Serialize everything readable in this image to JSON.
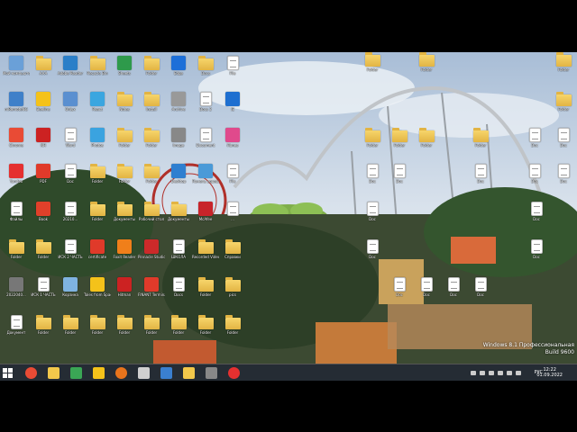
{
  "desktop": {
    "icons": [
      {
        "label": "Мой компьютер",
        "kind": "app",
        "color": "#6aa0d8"
      },
      {
        "label": "AAA",
        "kind": "folder",
        "color": "#f2c84b"
      },
      {
        "label": "Adobe Reader",
        "kind": "app",
        "color": "#2b7fc8"
      },
      {
        "label": "Recycle Bin",
        "kind": "folder",
        "color": "#f2c84b"
      },
      {
        "label": "Sheets",
        "kind": "app",
        "color": "#2e9a4b"
      },
      {
        "label": "Folder",
        "kind": "folder",
        "color": "#f2c84b"
      },
      {
        "label": "Edge",
        "kind": "app",
        "color": "#1d6fd8"
      },
      {
        "label": "Docs",
        "kind": "folder",
        "color": "#f2c84b"
      },
      {
        "label": "File",
        "kind": "doc",
        "color": "#ffffff"
      },
      {
        "label": "mRemoteNG",
        "kind": "app",
        "color": "#3f80c9"
      },
      {
        "label": "Beeline",
        "kind": "app",
        "color": "#f4c21a"
      },
      {
        "label": "Onlyx",
        "kind": "app",
        "color": "#5a8fd0"
      },
      {
        "label": "React",
        "kind": "app",
        "color": "#3ba6e0"
      },
      {
        "label": "Notes",
        "kind": "folder",
        "color": "#f2c84b"
      },
      {
        "label": "Install",
        "kind": "folder",
        "color": "#f2c84b"
      },
      {
        "label": "Archive",
        "kind": "app",
        "color": "#999999"
      },
      {
        "label": "Docs 2",
        "kind": "doc",
        "color": "#ffffff"
      },
      {
        "label": "IE",
        "kind": "app",
        "color": "#1e6fd0"
      },
      {
        "label": "Chrome",
        "kind": "app",
        "color": "#e94b35"
      },
      {
        "label": "NH",
        "kind": "app",
        "color": "#cc2222"
      },
      {
        "label": "Word",
        "kind": "doc",
        "color": "#ffffff"
      },
      {
        "label": "Photos",
        "kind": "app",
        "color": "#3aa3e0"
      },
      {
        "label": "Folder",
        "kind": "folder",
        "color": "#f2c84b"
      },
      {
        "label": "Folder",
        "kind": "folder",
        "color": "#f2c84b"
      },
      {
        "label": "Image",
        "kind": "app",
        "color": "#888888"
      },
      {
        "label": "Document",
        "kind": "doc",
        "color": "#ffffff"
      },
      {
        "label": "iTunes",
        "kind": "app",
        "color": "#e04a8c"
      },
      {
        "label": "Yandex",
        "kind": "app",
        "color": "#e53030"
      },
      {
        "label": "PDF",
        "kind": "app",
        "color": "#e03a2a"
      },
      {
        "label": "Doc",
        "kind": "doc",
        "color": "#ffffff"
      },
      {
        "label": "Folder",
        "kind": "folder",
        "color": "#f2c84b"
      },
      {
        "label": "Folder",
        "kind": "folder",
        "color": "#f2c84b"
      },
      {
        "label": "Folder",
        "kind": "folder",
        "color": "#f2c84b"
      },
      {
        "label": "Desktop",
        "kind": "app",
        "color": "#2f7fd0"
      },
      {
        "label": "Панель управления",
        "kind": "app",
        "color": "#4a9ad8"
      },
      {
        "label": "File",
        "kind": "doc",
        "color": "#ffffff"
      },
      {
        "label": "Файлы",
        "kind": "doc",
        "color": "#ffffff"
      },
      {
        "label": "Book",
        "kind": "app",
        "color": "#e0402a"
      },
      {
        "label": "20210...",
        "kind": "doc",
        "color": "#ffffff"
      },
      {
        "label": "Folder",
        "kind": "folder",
        "color": "#f2c84b"
      },
      {
        "label": "Документы",
        "kind": "folder",
        "color": "#f2c84b"
      },
      {
        "label": "Рабочий стол",
        "kind": "folder",
        "color": "#f2c84b"
      },
      {
        "label": "Документы",
        "kind": "folder",
        "color": "#f2c84b"
      },
      {
        "label": "McAfee",
        "kind": "app",
        "color": "#c8242a"
      },
      {
        "label": "...",
        "kind": "doc",
        "color": "#ffffff"
      },
      {
        "label": "Folder",
        "kind": "folder",
        "color": "#f2c84b"
      },
      {
        "label": "Folder",
        "kind": "folder",
        "color": "#f2c84b"
      },
      {
        "label": "ИСК 2 ЧАСТЬ",
        "kind": "doc",
        "color": "#ffffff"
      },
      {
        "label": "certificate",
        "kind": "app",
        "color": "#e03a2a"
      },
      {
        "label": "Foxit Reader",
        "kind": "app",
        "color": "#f07f1a"
      },
      {
        "label": "Pinnacle Studio",
        "kind": "app",
        "color": "#cc2a2a"
      },
      {
        "label": "ШКОЛА",
        "kind": "doc",
        "color": "#ffffff"
      },
      {
        "label": "Recorded Videos",
        "kind": "folder",
        "color": "#f2c84b"
      },
      {
        "label": "Справки",
        "kind": "folder",
        "color": "#f2c84b"
      },
      {
        "label": "2022040...",
        "kind": "app",
        "color": "#777777"
      },
      {
        "label": "ИСК 1 ЧАСТЬ",
        "kind": "doc",
        "color": "#ffffff"
      },
      {
        "label": "Корзина",
        "kind": "app",
        "color": "#7fb3e0"
      },
      {
        "label": "Tales from Space",
        "kind": "app",
        "color": "#f4c21a"
      },
      {
        "label": "Hitman",
        "kind": "app",
        "color": "#cc2222"
      },
      {
        "label": "FINANT Terminal",
        "kind": "app",
        "color": "#e03a2a"
      },
      {
        "label": "Docs",
        "kind": "doc",
        "color": "#ffffff"
      },
      {
        "label": "Folder",
        "kind": "folder",
        "color": "#f2c84b"
      },
      {
        "label": "pics",
        "kind": "folder",
        "color": "#f2c84b"
      },
      {
        "label": "Документ",
        "kind": "doc",
        "color": "#ffffff"
      },
      {
        "label": "Folder",
        "kind": "folder",
        "color": "#f2c84b"
      },
      {
        "label": "Folder",
        "kind": "folder",
        "color": "#f2c84b"
      },
      {
        "label": "Folder",
        "kind": "folder",
        "color": "#f2c84b"
      },
      {
        "label": "Folder",
        "kind": "folder",
        "color": "#f2c84b"
      },
      {
        "label": "Folder",
        "kind": "folder",
        "color": "#f2c84b"
      },
      {
        "label": "Folder",
        "kind": "folder",
        "color": "#f2c84b"
      },
      {
        "label": "Folder",
        "kind": "folder",
        "color": "#f2c84b"
      },
      {
        "label": "Folder",
        "kind": "folder",
        "color": "#f2c84b"
      },
      {
        "label": "Folder",
        "kind": "folder",
        "color": "#f2c84b"
      },
      {
        "label": "Folder",
        "kind": "folder",
        "color": "#f2c84b"
      },
      {
        "label": "Folder",
        "kind": "folder",
        "color": "#f2c84b"
      },
      {
        "label": "Folder",
        "kind": "folder",
        "color": "#f2c84b"
      },
      {
        "label": "Folder",
        "kind": "folder",
        "color": "#f2c84b"
      },
      {
        "label": "Folder",
        "kind": "folder",
        "color": "#f2c84b"
      },
      {
        "label": "Folder",
        "kind": "folder",
        "color": "#f2c84b"
      },
      {
        "label": "Folder",
        "kind": "folder",
        "color": "#f2c84b"
      },
      {
        "label": "Doc",
        "kind": "doc",
        "color": "#ffffff"
      },
      {
        "label": "Doc",
        "kind": "doc",
        "color": "#ffffff"
      },
      {
        "label": "Doc",
        "kind": "doc",
        "color": "#ffffff"
      },
      {
        "label": "Doc",
        "kind": "doc",
        "color": "#ffffff"
      },
      {
        "label": "Doc",
        "kind": "doc",
        "color": "#ffffff"
      },
      {
        "label": "Doc",
        "kind": "doc",
        "color": "#ffffff"
      },
      {
        "label": "Doc",
        "kind": "doc",
        "color": "#ffffff"
      },
      {
        "label": "Doc",
        "kind": "doc",
        "color": "#ffffff"
      },
      {
        "label": "Doc",
        "kind": "doc",
        "color": "#ffffff"
      },
      {
        "label": "Doc",
        "kind": "doc",
        "color": "#ffffff"
      },
      {
        "label": "Doc",
        "kind": "doc",
        "color": "#ffffff"
      },
      {
        "label": "Doc",
        "kind": "doc",
        "color": "#ffffff"
      },
      {
        "label": "Doc",
        "kind": "doc",
        "color": "#ffffff"
      },
      {
        "label": "Doc",
        "kind": "doc",
        "color": "#ffffff"
      },
      {
        "label": "Doc",
        "kind": "doc",
        "color": "#ffffff"
      }
    ]
  },
  "watermark": {
    "line1": "Windows 8.1 Профессиональная",
    "line2": "Build 9600"
  },
  "taskbar": {
    "apps": [
      {
        "name": "chrome",
        "color": "#e94b35"
      },
      {
        "name": "explorer",
        "color": "#f2c84b"
      },
      {
        "name": "app",
        "color": "#3aa655"
      },
      {
        "name": "app",
        "color": "#f4c21a"
      },
      {
        "name": "firefox",
        "color": "#e8741c"
      },
      {
        "name": "app",
        "color": "#d0d0d0"
      },
      {
        "name": "app",
        "color": "#3a7fd0"
      },
      {
        "name": "explorer",
        "color": "#f2c84b"
      },
      {
        "name": "app",
        "color": "#888888"
      },
      {
        "name": "yandex",
        "color": "#e53030"
      }
    ],
    "language": "РУС",
    "time": "12:22",
    "date": "01.09.2022"
  }
}
